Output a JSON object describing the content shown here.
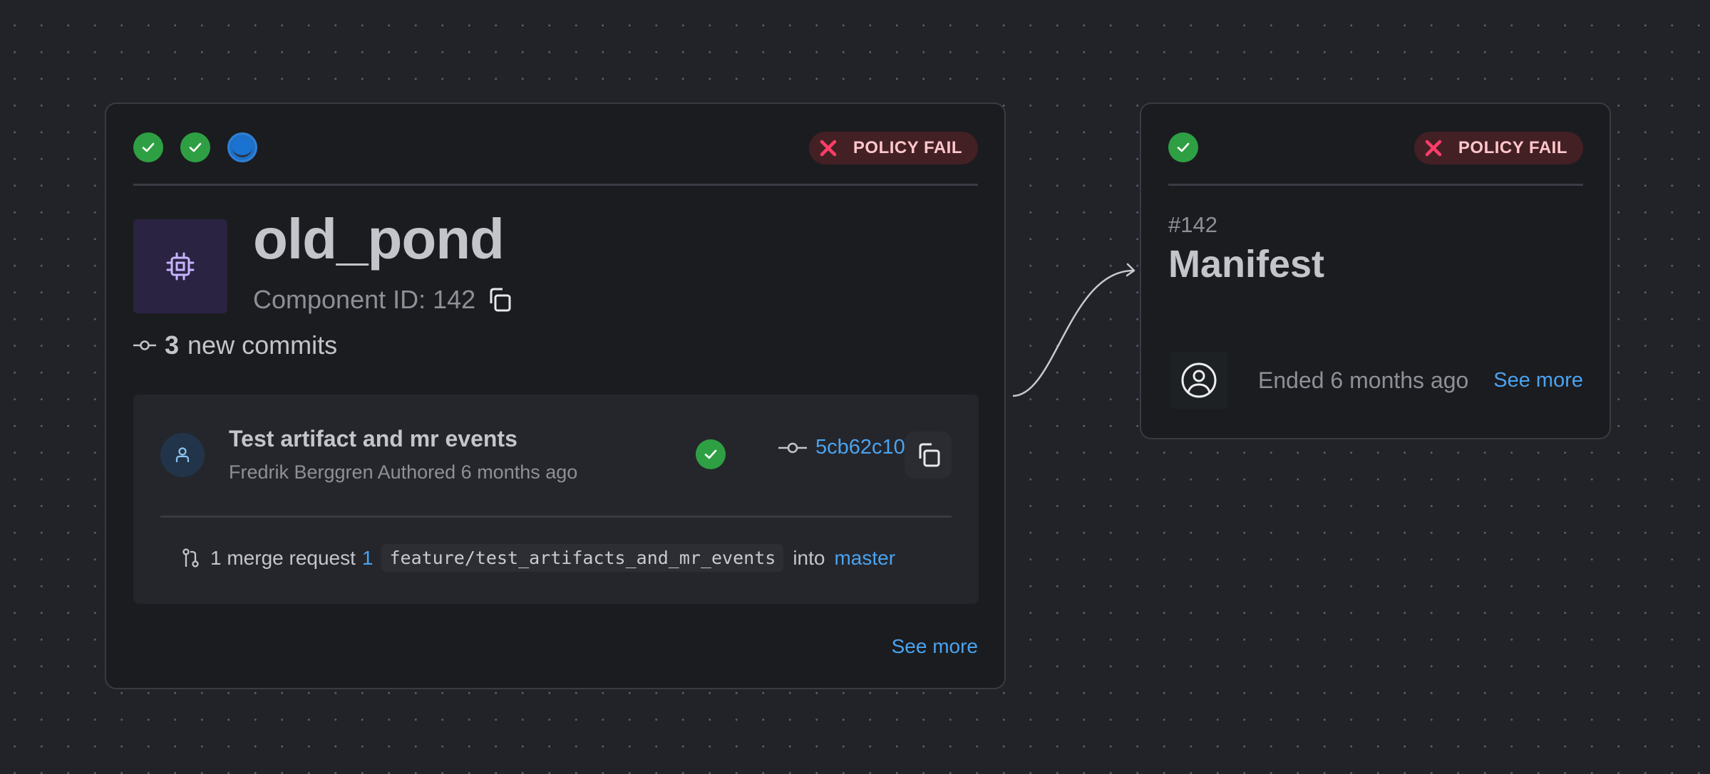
{
  "canvas": {
    "background": "dot-grid"
  },
  "colors": {
    "success": "#2ea043",
    "running": "#1f6fc5",
    "policy_fail_bg": "#432024",
    "policy_fail_text": "#ffc7cc",
    "policy_fail_icon": "#ff3d6a",
    "link": "#4aa3f0",
    "component_icon_bg": "#2b2342",
    "component_icon": "#c6b4ff"
  },
  "component_card": {
    "statuses": [
      {
        "state": "success",
        "icon": "check-icon"
      },
      {
        "state": "success",
        "icon": "check-icon"
      },
      {
        "state": "running",
        "icon": "spinner-icon"
      }
    ],
    "policy_badge": {
      "icon": "x-icon",
      "label": "POLICY FAIL"
    },
    "icon": "cpu-chip-icon",
    "title": "old_pond",
    "component_id_label": "Component ID: 142",
    "new_commits": {
      "icon": "commit-icon",
      "count": "3",
      "label": "new commits"
    },
    "commit": {
      "avatar_icon": "user-icon",
      "title": "Test artifact and mr events",
      "subtitle": "Fredrik Berggren Authored 6 months ago",
      "status": "success",
      "sha": "5cb62c10",
      "copy_icon": "copy-icon"
    },
    "merge_request": {
      "icon": "merge-request-icon",
      "label": "1 merge request",
      "number": "1",
      "source_branch": "feature/test_artifacts_and_mr_events",
      "into": "into",
      "target_branch": "master"
    },
    "see_more": "See more"
  },
  "edge": {
    "from": "component_card",
    "to": "manifest_card",
    "arrow": "arrowhead"
  },
  "manifest_card": {
    "statuses": [
      {
        "state": "success",
        "icon": "check-icon"
      }
    ],
    "policy_badge": {
      "icon": "x-icon",
      "label": "POLICY FAIL"
    },
    "run_number": "#142",
    "title": "Manifest",
    "user_icon": "user-circle-icon",
    "ended": "Ended 6 months ago",
    "see_more": "See more"
  }
}
